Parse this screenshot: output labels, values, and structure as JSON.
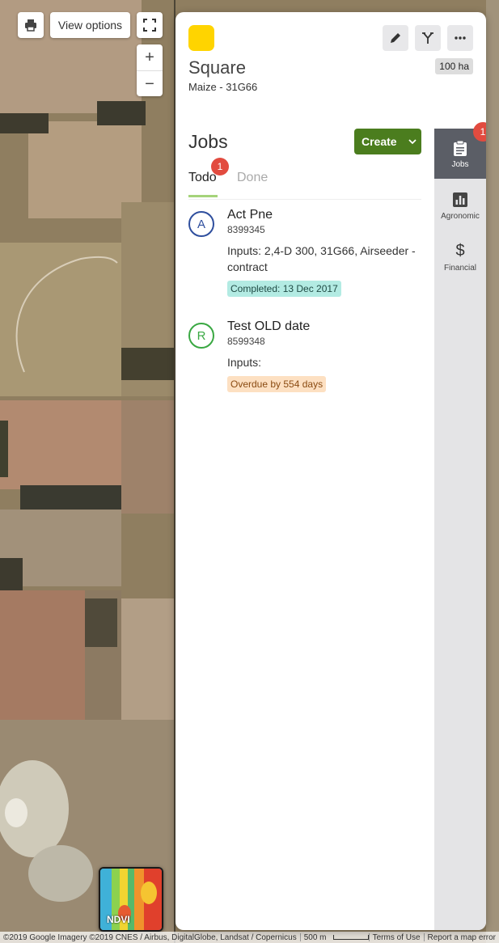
{
  "map": {
    "view_options_label": "View options",
    "zoom_in_label": "+",
    "zoom_out_label": "−",
    "ndvi_label": "NDVI",
    "attribution": "©2019 Google Imagery ©2019 CNES / Airbus, DigitalGlobe, Landsat / Copernicus",
    "scale_label": "500 m",
    "terms_label": "Terms of Use",
    "report_label": "Report a map error"
  },
  "field": {
    "name": "Square",
    "crop": "Maize - 31G66",
    "area": "100 ha",
    "color": "#ffd400"
  },
  "jobs": {
    "title": "Jobs",
    "create_label": "Create",
    "tabs": [
      {
        "label": "Todo",
        "badge": "1"
      },
      {
        "label": "Done"
      }
    ],
    "items": [
      {
        "avatar": "A",
        "avatar_color": "#2f4f9e",
        "name": "Act Pne",
        "code": "8399345",
        "inputs": "Inputs: 2,4-D 300, 31G66, Airseeder - contract",
        "status": "Completed: 13 Dec 2017",
        "status_bg": "#b3ebe3"
      },
      {
        "avatar": "R",
        "avatar_color": "#3aa843",
        "name": "Test OLD date",
        "code": "8599348",
        "inputs": "Inputs:",
        "status": "Overdue by 554 days",
        "status_bg": "#fde0c2"
      }
    ]
  },
  "rail": {
    "items": [
      {
        "label": "Jobs",
        "icon": "clipboard-icon",
        "badge": "1"
      },
      {
        "label": "Agronomic",
        "icon": "bar-chart-icon"
      },
      {
        "label": "Financial",
        "icon": "dollar-icon"
      }
    ]
  }
}
